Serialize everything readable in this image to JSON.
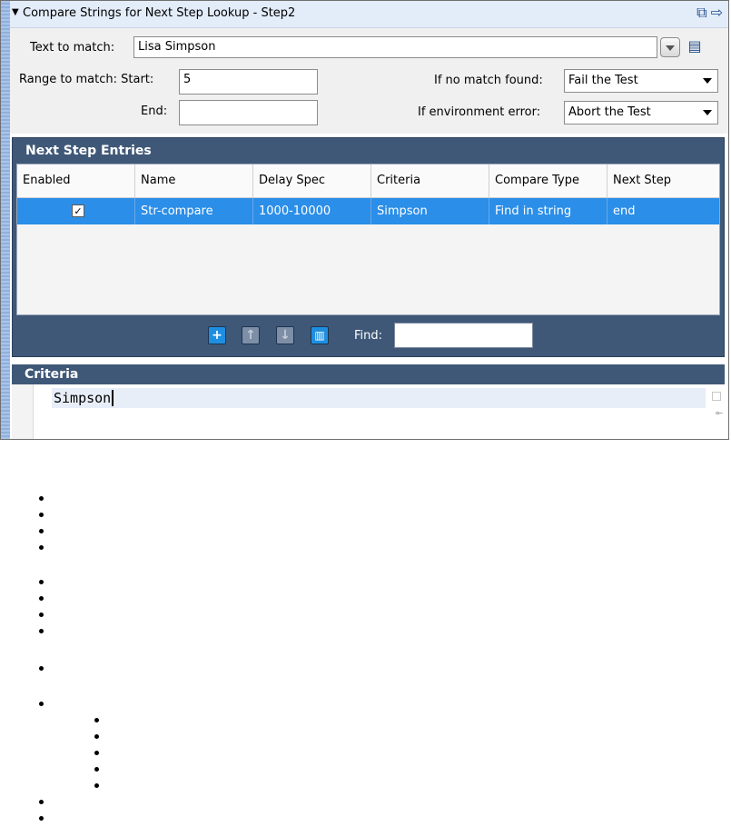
{
  "header": {
    "title": "Compare Strings for Next Step Lookup - Step2",
    "collapse_icon": "triangle-down-icon",
    "icons": [
      "window-icon",
      "arrow-right-icon"
    ]
  },
  "settings": {
    "text_to_match_label": "Text to match:",
    "text_to_match_value": "Lisa Simpson",
    "range_label": "Range to match: Start:",
    "start_value": "5",
    "end_label": "End:",
    "end_value": "",
    "no_match_label": "If no match found:",
    "no_match_value": "Fail the Test",
    "env_error_label": "If environment error:",
    "env_error_value": "Abort the Test"
  },
  "next_step_entries": {
    "title": "Next Step Entries",
    "columns": [
      "Enabled",
      "Name",
      "Delay Spec",
      "Criteria",
      "Compare Type",
      "Next Step"
    ],
    "rows": [
      {
        "enabled": true,
        "name": "Str-compare",
        "delay_spec": "1000-10000",
        "criteria": "Simpson",
        "compare_type": "Find in string",
        "next_step": "end"
      }
    ],
    "toolbar_icons": [
      "add-icon",
      "move-up-icon",
      "move-down-icon",
      "delete-icon"
    ],
    "find_label": "Find:",
    "find_value": ""
  },
  "criteria": {
    "title": "Criteria",
    "text": "Simpson"
  },
  "colors": {
    "section_bar": "#3f5878",
    "selected_row": "#2b8ee8",
    "header_bg": "#e3ecf9"
  }
}
